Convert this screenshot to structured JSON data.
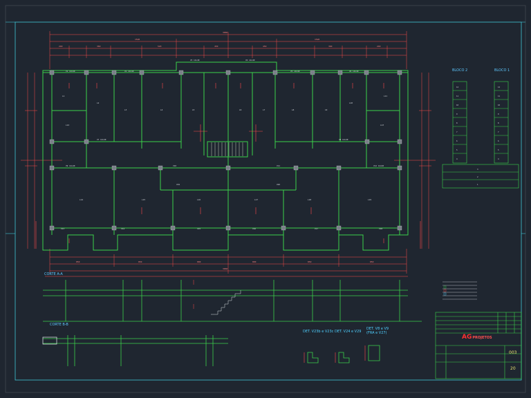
{
  "drawing": {
    "sections": {
      "section_a": "CORTE A-A",
      "section_b": "CORTE B-B"
    },
    "blocks": {
      "block_2": "BLOCO 2",
      "block_1": "BLOCO 1"
    },
    "details": {
      "detail_1": "DET. V23b e V23c",
      "detail_2": "DET. V24 e V29",
      "detail_3": "DET. V8 e V9",
      "detail_3_sub": "(FRA e V27)"
    },
    "title_block": {
      "logo": "AG",
      "logo_tail": "PROJETOS",
      "sheet_code": "003",
      "sheet_number": "20"
    },
    "colors": {
      "background": "#1f2630",
      "walls": "#3bd24a",
      "dimensions": "#ff4a4a",
      "annotations": "#ffffff",
      "labels": "#4fd0ff",
      "border": "#40c8d8"
    }
  }
}
